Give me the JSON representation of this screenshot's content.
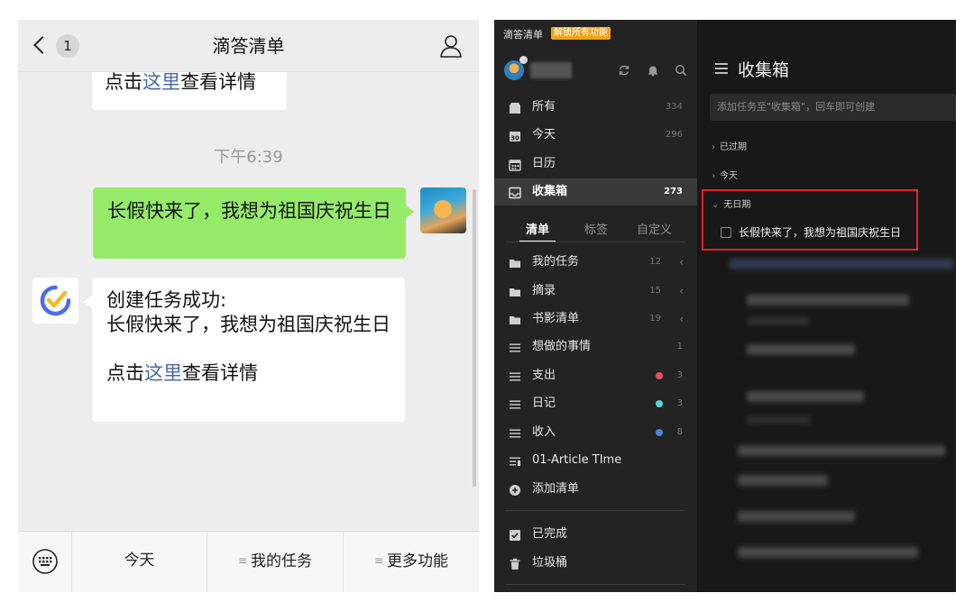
{
  "wechat": {
    "back_badge": "1",
    "title": "滴答清单",
    "messages": {
      "top_bubble": {
        "prefix": "点击",
        "link": "这里",
        "suffix": "查看详情"
      },
      "timestamp": "下午6:39",
      "user_message": "长假快来了，我想为祖国庆祝生日",
      "bot_reply": {
        "line1": "创建任务成功:",
        "line2": "长假快来了，我想为祖国庆祝生日",
        "prefix": "点击",
        "link": "这里",
        "suffix": "查看详情"
      }
    },
    "footer": {
      "keyboard_icon": "keyboard-icon",
      "items": [
        "今天",
        "我的任务",
        "更多功能"
      ]
    }
  },
  "ticktick": {
    "app_name": "滴答清单",
    "unlock_badge": "解锁所有功能",
    "top_icons": [
      "sync-icon",
      "bell-icon",
      "search-icon"
    ],
    "smart_lists": [
      {
        "label": "所有",
        "count": "334",
        "icon": "all-icon"
      },
      {
        "label": "今天",
        "count": "296",
        "icon": "calendar-30-icon"
      },
      {
        "label": "日历",
        "count": "",
        "icon": "calendar-icon"
      },
      {
        "label": "收集箱",
        "count": "273",
        "icon": "inbox-icon",
        "active": true
      }
    ],
    "tabs": [
      "清单",
      "标签",
      "自定义"
    ],
    "lists": [
      {
        "label": "我的任务",
        "count": "12",
        "type": "folder"
      },
      {
        "label": "摘录",
        "count": "15",
        "type": "folder"
      },
      {
        "label": "书影清单",
        "count": "19",
        "type": "folder"
      },
      {
        "label": "想做的事情",
        "count": "1",
        "type": "list"
      },
      {
        "label": "支出",
        "count": "3",
        "type": "list",
        "dot": "#e05555"
      },
      {
        "label": "日记",
        "count": "3",
        "type": "list",
        "dot": "#57d8d8"
      },
      {
        "label": "收入",
        "count": "8",
        "type": "list",
        "dot": "#4a84e0"
      },
      {
        "label": "01-Article TIme",
        "count": "",
        "type": "list"
      }
    ],
    "add_list": "添加清单",
    "completed": "已完成",
    "trash": "垃圾桶",
    "main": {
      "title": "收集箱",
      "add_placeholder": "添加任务至\"收集箱\"，回车即可创建",
      "groups": [
        "已过期",
        "今天",
        "无日期"
      ],
      "task": "长假快来了，我想为祖国庆祝生日"
    },
    "colors": {
      "accent_red": "#e3202a",
      "unlock_orange": "#f0a31e",
      "wechat_green": "#95ec69"
    }
  }
}
